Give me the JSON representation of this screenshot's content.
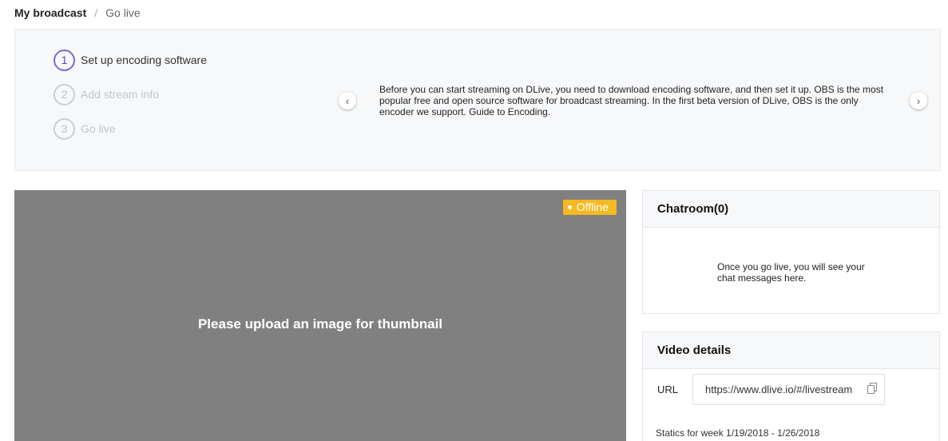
{
  "breadcrumb": {
    "parent": "My broadcast",
    "separator": "/",
    "current": "Go live"
  },
  "setup": {
    "steps": [
      {
        "number": "1",
        "label": "Set up encoding software",
        "active": true
      },
      {
        "number": "2",
        "label": "Add stream info",
        "active": false
      },
      {
        "number": "3",
        "label": "Go live",
        "active": false
      }
    ],
    "description": "Before you can start streaming on DLive, you need to download encoding software, and then set it up. OBS is the most popular free and open source software for broadcast streaming. In the first beta version of DLive, OBS is the only encoder we support. Guide to Encoding.",
    "prev_icon": "chevron-left-icon",
    "next_icon": "chevron-right-icon"
  },
  "video": {
    "status_badge": "Offline",
    "placeholder": "Please upload an image for thumbnail"
  },
  "chatroom": {
    "title": "Chatroom(0)",
    "message": "Once you go live, you will see your chat messages here."
  },
  "video_details": {
    "title": "Video details",
    "url_label": "URL",
    "url_value": "https://www.dlive.io/#/livestream",
    "copy_icon": "copy-icon",
    "stats": "Statics for week 1/19/2018 - 1/26/2018"
  },
  "colors": {
    "accent": "#7c67d8",
    "offline_badge": "#f5b921",
    "video_bg": "#808080"
  }
}
